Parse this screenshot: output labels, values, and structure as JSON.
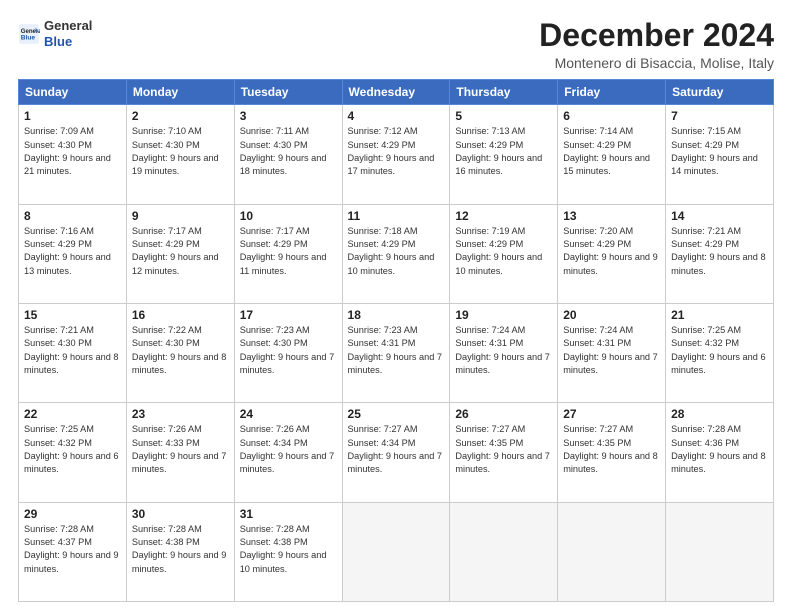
{
  "logo": {
    "line1": "General",
    "line2": "Blue"
  },
  "title": "December 2024",
  "location": "Montenero di Bisaccia, Molise, Italy",
  "days_of_week": [
    "Sunday",
    "Monday",
    "Tuesday",
    "Wednesday",
    "Thursday",
    "Friday",
    "Saturday"
  ],
  "weeks": [
    [
      {
        "day": 1,
        "sunrise": "7:09 AM",
        "sunset": "4:30 PM",
        "daylight": "9 hours and 21 minutes."
      },
      {
        "day": 2,
        "sunrise": "7:10 AM",
        "sunset": "4:30 PM",
        "daylight": "9 hours and 19 minutes."
      },
      {
        "day": 3,
        "sunrise": "7:11 AM",
        "sunset": "4:30 PM",
        "daylight": "9 hours and 18 minutes."
      },
      {
        "day": 4,
        "sunrise": "7:12 AM",
        "sunset": "4:29 PM",
        "daylight": "9 hours and 17 minutes."
      },
      {
        "day": 5,
        "sunrise": "7:13 AM",
        "sunset": "4:29 PM",
        "daylight": "9 hours and 16 minutes."
      },
      {
        "day": 6,
        "sunrise": "7:14 AM",
        "sunset": "4:29 PM",
        "daylight": "9 hours and 15 minutes."
      },
      {
        "day": 7,
        "sunrise": "7:15 AM",
        "sunset": "4:29 PM",
        "daylight": "9 hours and 14 minutes."
      }
    ],
    [
      {
        "day": 8,
        "sunrise": "7:16 AM",
        "sunset": "4:29 PM",
        "daylight": "9 hours and 13 minutes."
      },
      {
        "day": 9,
        "sunrise": "7:17 AM",
        "sunset": "4:29 PM",
        "daylight": "9 hours and 12 minutes."
      },
      {
        "day": 10,
        "sunrise": "7:17 AM",
        "sunset": "4:29 PM",
        "daylight": "9 hours and 11 minutes."
      },
      {
        "day": 11,
        "sunrise": "7:18 AM",
        "sunset": "4:29 PM",
        "daylight": "9 hours and 10 minutes."
      },
      {
        "day": 12,
        "sunrise": "7:19 AM",
        "sunset": "4:29 PM",
        "daylight": "9 hours and 10 minutes."
      },
      {
        "day": 13,
        "sunrise": "7:20 AM",
        "sunset": "4:29 PM",
        "daylight": "9 hours and 9 minutes."
      },
      {
        "day": 14,
        "sunrise": "7:21 AM",
        "sunset": "4:29 PM",
        "daylight": "9 hours and 8 minutes."
      }
    ],
    [
      {
        "day": 15,
        "sunrise": "7:21 AM",
        "sunset": "4:30 PM",
        "daylight": "9 hours and 8 minutes."
      },
      {
        "day": 16,
        "sunrise": "7:22 AM",
        "sunset": "4:30 PM",
        "daylight": "9 hours and 8 minutes."
      },
      {
        "day": 17,
        "sunrise": "7:23 AM",
        "sunset": "4:30 PM",
        "daylight": "9 hours and 7 minutes."
      },
      {
        "day": 18,
        "sunrise": "7:23 AM",
        "sunset": "4:31 PM",
        "daylight": "9 hours and 7 minutes."
      },
      {
        "day": 19,
        "sunrise": "7:24 AM",
        "sunset": "4:31 PM",
        "daylight": "9 hours and 7 minutes."
      },
      {
        "day": 20,
        "sunrise": "7:24 AM",
        "sunset": "4:31 PM",
        "daylight": "9 hours and 7 minutes."
      },
      {
        "day": 21,
        "sunrise": "7:25 AM",
        "sunset": "4:32 PM",
        "daylight": "9 hours and 6 minutes."
      }
    ],
    [
      {
        "day": 22,
        "sunrise": "7:25 AM",
        "sunset": "4:32 PM",
        "daylight": "9 hours and 6 minutes."
      },
      {
        "day": 23,
        "sunrise": "7:26 AM",
        "sunset": "4:33 PM",
        "daylight": "9 hours and 7 minutes."
      },
      {
        "day": 24,
        "sunrise": "7:26 AM",
        "sunset": "4:34 PM",
        "daylight": "9 hours and 7 minutes."
      },
      {
        "day": 25,
        "sunrise": "7:27 AM",
        "sunset": "4:34 PM",
        "daylight": "9 hours and 7 minutes."
      },
      {
        "day": 26,
        "sunrise": "7:27 AM",
        "sunset": "4:35 PM",
        "daylight": "9 hours and 7 minutes."
      },
      {
        "day": 27,
        "sunrise": "7:27 AM",
        "sunset": "4:35 PM",
        "daylight": "9 hours and 8 minutes."
      },
      {
        "day": 28,
        "sunrise": "7:28 AM",
        "sunset": "4:36 PM",
        "daylight": "9 hours and 8 minutes."
      }
    ],
    [
      {
        "day": 29,
        "sunrise": "7:28 AM",
        "sunset": "4:37 PM",
        "daylight": "9 hours and 9 minutes."
      },
      {
        "day": 30,
        "sunrise": "7:28 AM",
        "sunset": "4:38 PM",
        "daylight": "9 hours and 9 minutes."
      },
      {
        "day": 31,
        "sunrise": "7:28 AM",
        "sunset": "4:38 PM",
        "daylight": "9 hours and 10 minutes."
      },
      null,
      null,
      null,
      null
    ]
  ]
}
